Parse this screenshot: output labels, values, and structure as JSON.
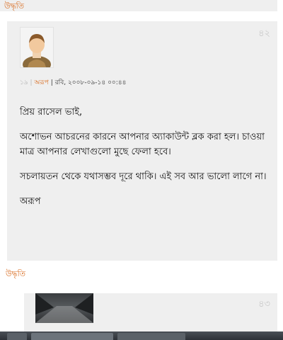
{
  "quote_label": "উদ্ধৃতি",
  "comment": {
    "number": "৪২",
    "meta": {
      "prefix": "১৯",
      "author": "অরূপ",
      "sep": " | ",
      "datetime": "রবি, ২০০৮-০৯-১৪ ০০:৪৪"
    },
    "paragraphs": [
      "প্রিয় রাসেল ভাই,",
      "অশোভন আচরনের কারনে আপনার অ্যাকাউন্ট ব্লক করা হল। চাওয়া মাত্র আপনার লেখাগুলো মুছে ফেলা হবে।",
      "সচলায়তন থেকে যথাসম্ভব দূরে থাকি। এই সব আর ভালো লাগে না।",
      "অরূপ"
    ]
  },
  "comment2": {
    "number": "৪৩"
  }
}
